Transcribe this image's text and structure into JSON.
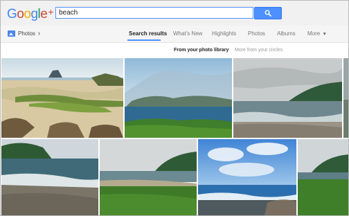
{
  "header": {
    "logo_text": "Google",
    "logo_plus": "+",
    "search_value": "beach"
  },
  "nav": {
    "section_label": "Photos",
    "tabs": [
      {
        "label": "Search results",
        "active": true
      },
      {
        "label": "What's New",
        "active": false
      },
      {
        "label": "Highlights",
        "active": false
      },
      {
        "label": "Photos",
        "active": false
      },
      {
        "label": "Albums",
        "active": false
      },
      {
        "label": "More",
        "active": false
      }
    ]
  },
  "subtabs": [
    {
      "label": "From your photo library",
      "active": true
    },
    {
      "label": "More from your circles",
      "active": false
    }
  ],
  "colors": {
    "accent_blue": "#4d90fe",
    "google_blue": "#4285f4",
    "google_red": "#d14836",
    "google_yellow": "#f4b400",
    "google_green": "#0f9d58"
  },
  "photos": [
    {
      "subject": "sandy beach with green algae rocks and island"
    },
    {
      "subject": "blue sea and cloudy mountains with green grass foreground"
    },
    {
      "subject": "grey sea with waves and green headland"
    },
    {
      "subject": "shore with green hill and pebble beach"
    },
    {
      "subject": "coast with grassy field and green mountain"
    },
    {
      "subject": "blue sky with clouds over rocky shore"
    },
    {
      "subject": "cropped sea with green grass shore"
    },
    {
      "subject": "hillside with grey sky"
    }
  ]
}
